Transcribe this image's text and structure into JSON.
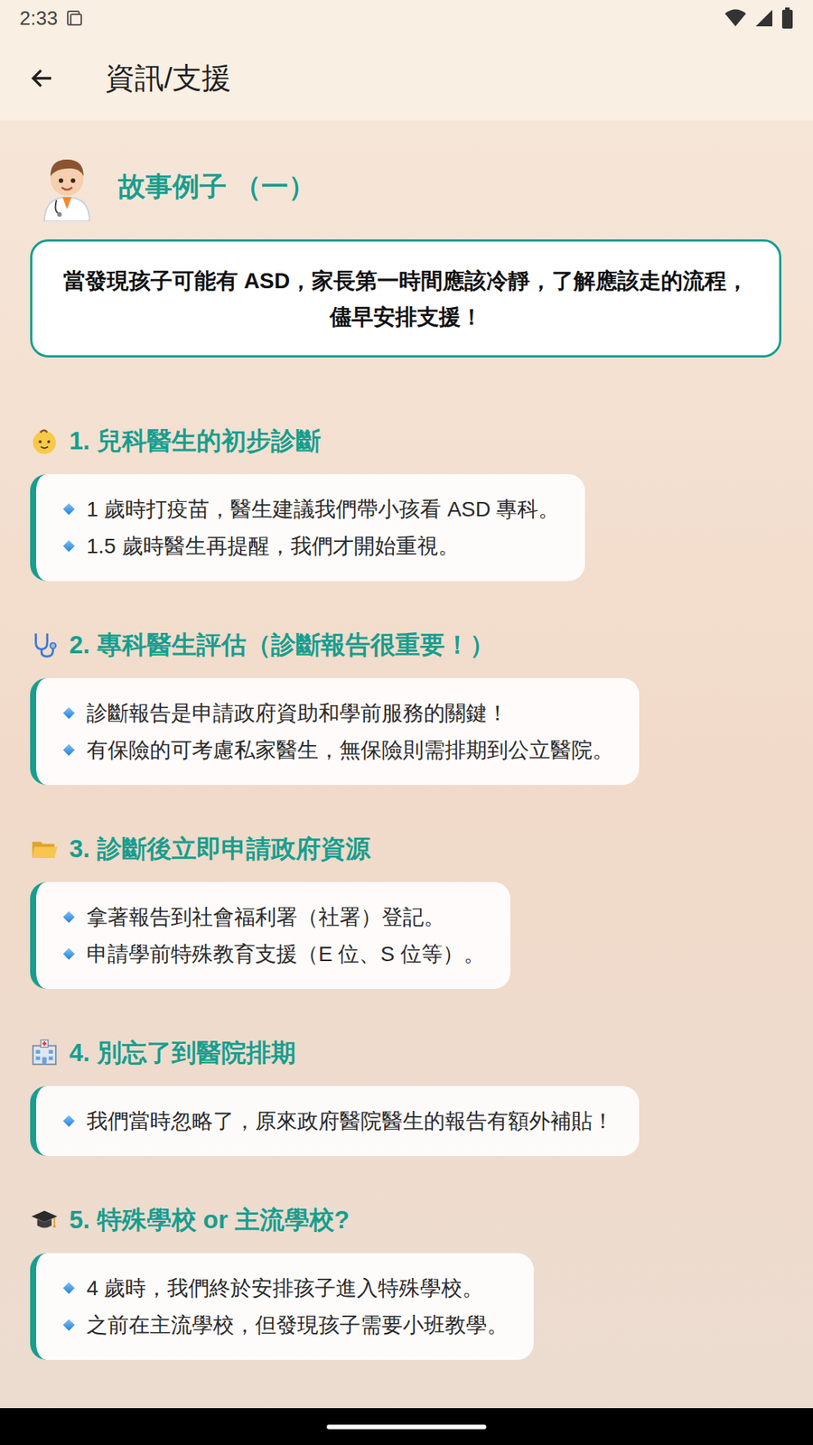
{
  "status_bar": {
    "time": "2:33"
  },
  "app_bar": {
    "title": "資訊/支援"
  },
  "story": {
    "title": "故事例子 （一）"
  },
  "callout": {
    "text": "當發現孩子可能有 ASD，家長第一時間應該冷靜，了解應該走的流程，儘早安排支援！"
  },
  "sections": [
    {
      "title": "1. 兒科醫生的初步診斷",
      "bullets": [
        "1 歲時打疫苗，醫生建議我們帶小孩看 ASD 專科。",
        "1.5 歲時醫生再提醒，我們才開始重視。"
      ]
    },
    {
      "title": "2. 專科醫生評估（診斷報告很重要！）",
      "bullets": [
        "診斷報告是申請政府資助和學前服務的關鍵！",
        "有保險的可考慮私家醫生，無保險則需排期到公立醫院。"
      ]
    },
    {
      "title": "3. 診斷後立即申請政府資源",
      "bullets": [
        "拿著報告到社會福利署（社署）登記。",
        "申請學前特殊教育支援（E 位、S 位等）。"
      ]
    },
    {
      "title": "4. 別忘了到醫院排期",
      "bullets": [
        "我們當時忽略了，原來政府醫院醫生的報告有額外補貼！"
      ]
    },
    {
      "title": "5. 特殊學校 or 主流學校?",
      "bullets": [
        "4 歲時，我們終於安排孩子進入特殊學校。",
        "之前在主流學校，但發現孩子需要小班教學。"
      ]
    }
  ]
}
